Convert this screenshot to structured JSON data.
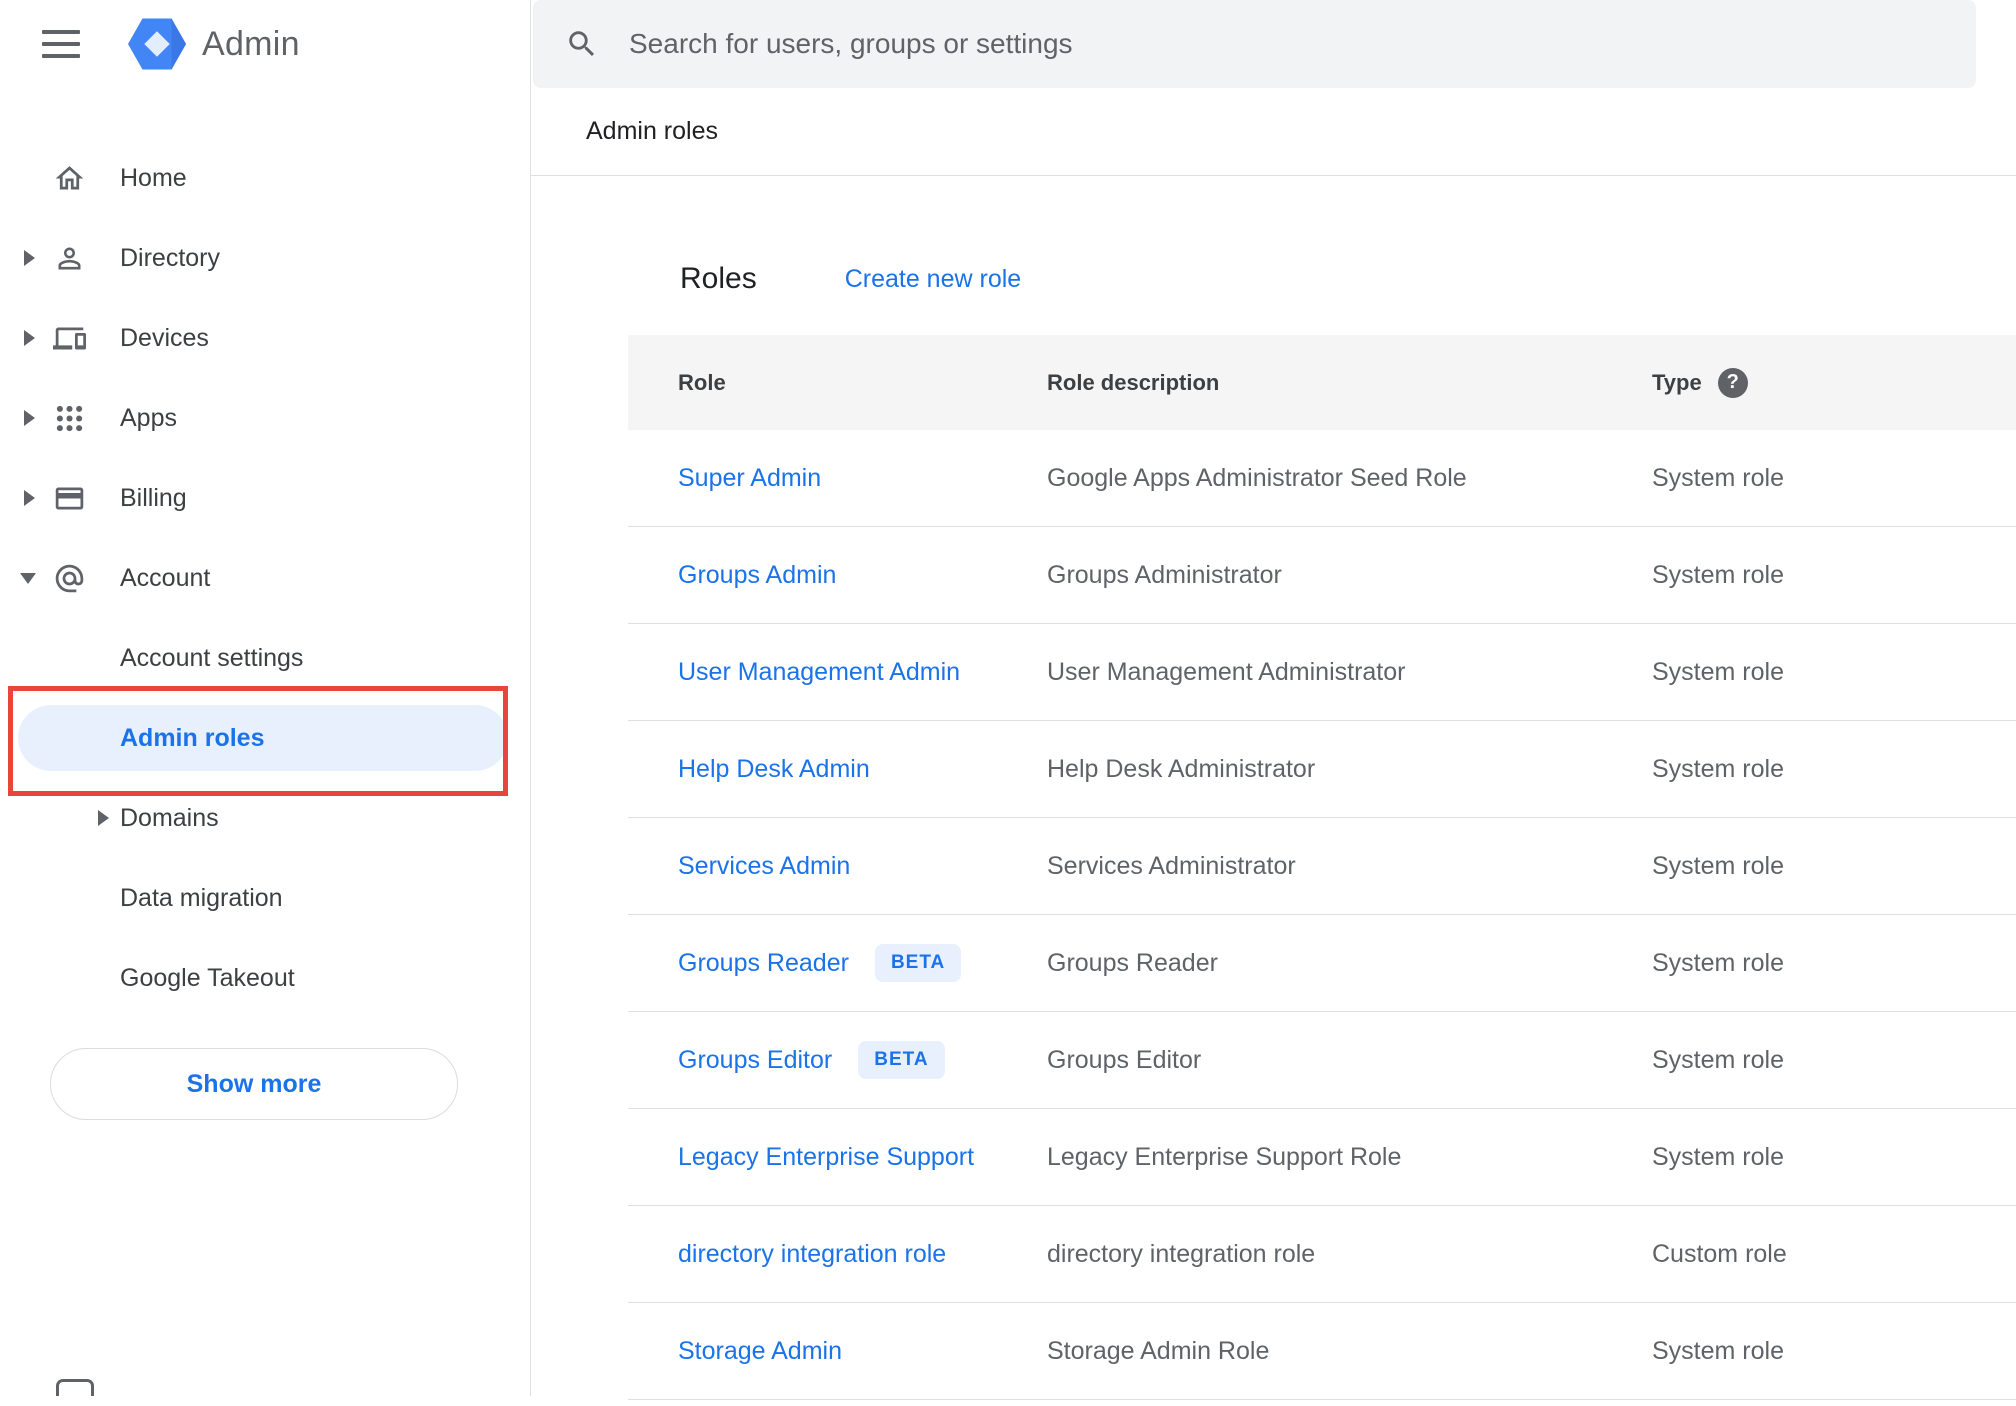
{
  "brand": {
    "name": "Admin"
  },
  "search": {
    "placeholder": "Search for users, groups or settings"
  },
  "breadcrumb": {
    "label": "Admin roles"
  },
  "sidebar": {
    "items": [
      {
        "label": "Home"
      },
      {
        "label": "Directory"
      },
      {
        "label": "Devices"
      },
      {
        "label": "Apps"
      },
      {
        "label": "Billing"
      },
      {
        "label": "Account"
      }
    ],
    "account_children": [
      {
        "label": "Account settings"
      },
      {
        "label": "Admin roles",
        "active": true
      },
      {
        "label": "Domains"
      },
      {
        "label": "Data migration"
      },
      {
        "label": "Google Takeout"
      }
    ],
    "show_more": "Show more"
  },
  "roles_card": {
    "title": "Roles",
    "create_link": "Create new role",
    "headers": {
      "role": "Role",
      "description": "Role description",
      "type": "Type"
    },
    "rows": [
      {
        "role": "Super Admin",
        "badge": "",
        "description": "Google Apps Administrator Seed Role",
        "type": "System role"
      },
      {
        "role": "Groups Admin",
        "badge": "",
        "description": "Groups Administrator",
        "type": "System role"
      },
      {
        "role": "User Management Admin",
        "badge": "",
        "description": "User Management Administrator",
        "type": "System role"
      },
      {
        "role": "Help Desk Admin",
        "badge": "",
        "description": "Help Desk Administrator",
        "type": "System role"
      },
      {
        "role": "Services Admin",
        "badge": "",
        "description": "Services Administrator",
        "type": "System role"
      },
      {
        "role": "Groups Reader",
        "badge": "BETA",
        "description": "Groups Reader",
        "type": "System role"
      },
      {
        "role": "Groups Editor",
        "badge": "BETA",
        "description": "Groups Editor",
        "type": "System role"
      },
      {
        "role": "Legacy Enterprise Support",
        "badge": "",
        "description": "Legacy Enterprise Support Role",
        "type": "System role"
      },
      {
        "role": "directory integration role",
        "badge": "",
        "description": "directory integration role",
        "type": "Custom role"
      },
      {
        "role": "Storage Admin",
        "badge": "",
        "description": "Storage Admin Role",
        "type": "System role"
      }
    ]
  },
  "icons": {
    "menu": "hamburger-menu-icon",
    "logo": "google-admin-hexagon-logo",
    "search": "search-icon",
    "home": "home-icon",
    "directory": "person-icon",
    "devices": "devices-icon",
    "apps": "apps-grid-icon",
    "billing": "credit-card-icon",
    "account": "at-sign-icon",
    "help": "help-icon",
    "help_glyph": "?"
  },
  "colors": {
    "accent_blue": "#1a73e8",
    "annotation_red": "#e8453c",
    "badge_bg": "#e8f0fe",
    "table_header_bg": "#f5f5f5",
    "search_bg": "#f1f3f4",
    "text_gray": "#5f6368"
  }
}
